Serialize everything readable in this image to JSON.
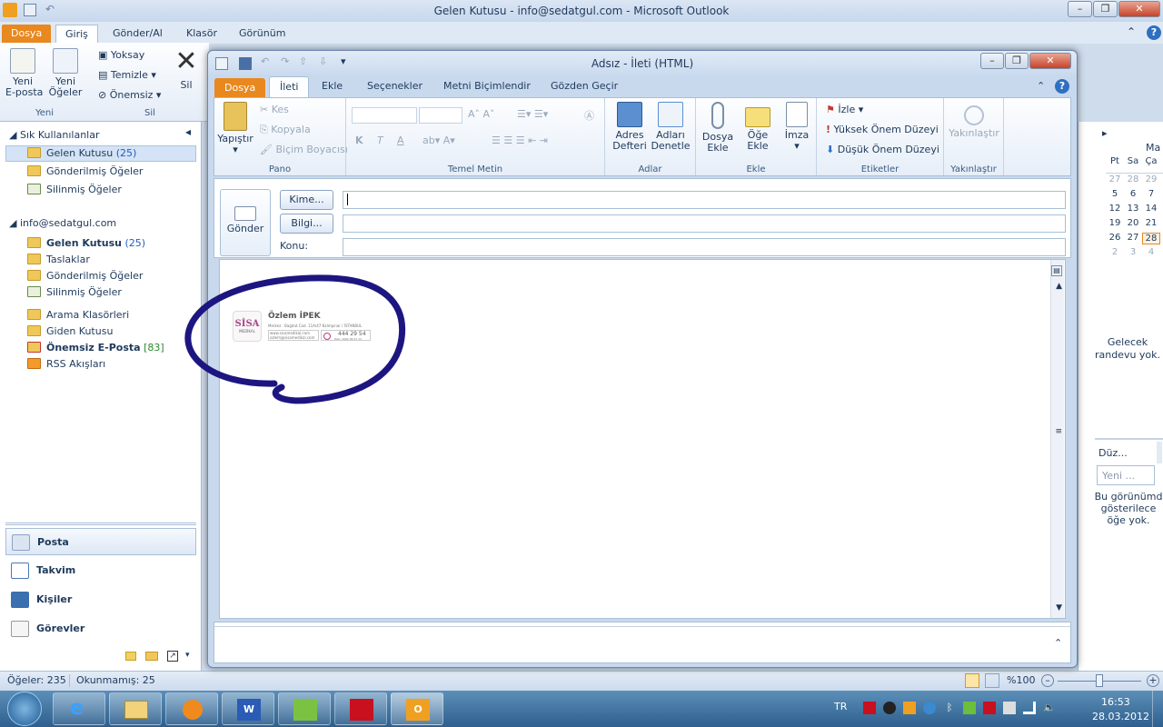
{
  "main_window": {
    "title": "Gelen Kutusu - info@sedatgul.com  -  Microsoft Outlook",
    "tabs": [
      "Dosya",
      "Giriş",
      "Gönder/Al",
      "Klasör",
      "Görünüm"
    ],
    "ribbon": {
      "new_email": "Yeni\nE-posta",
      "new_items": "Yeni\nÖğeler",
      "new_group": "Yeni",
      "ignore": "Yoksay",
      "clean": "Temizle",
      "junk": "Önemsiz",
      "delete": "Sil",
      "delete_group": "Sil"
    }
  },
  "nav": {
    "favorites_header": "Sık Kullanılanlar",
    "favorites": [
      {
        "name": "Gelen Kutusu",
        "count": "(25)"
      },
      {
        "name": "Gönderilmiş Öğeler",
        "count": ""
      },
      {
        "name": "Silinmiş Öğeler",
        "count": ""
      }
    ],
    "account_header": "info@sedatgul.com",
    "account_folders": [
      {
        "name": "Gelen Kutusu",
        "count": "(25)"
      },
      {
        "name": "Taslaklar",
        "count": ""
      },
      {
        "name": "Gönderilmiş Öğeler",
        "count": ""
      },
      {
        "name": "Silinmiş Öğeler",
        "count": ""
      },
      {
        "name": "Arama Klasörleri",
        "count": ""
      },
      {
        "name": "Giden Kutusu",
        "count": ""
      },
      {
        "name": "Önemsiz E-Posta",
        "count": "[83]"
      },
      {
        "name": "RSS Akışları",
        "count": ""
      }
    ],
    "modules": [
      "Posta",
      "Takvim",
      "Kişiler",
      "Görevler"
    ]
  },
  "right_pane": {
    "calendar_header": "Ma",
    "day_names": [
      "Pt",
      "Sa",
      "Ça"
    ],
    "weeks": [
      [
        "27",
        "28",
        "29"
      ],
      [
        "5",
        "6",
        "7"
      ],
      [
        "12",
        "13",
        "14"
      ],
      [
        "19",
        "20",
        "21"
      ],
      [
        "26",
        "27",
        "28"
      ],
      [
        "2",
        "3",
        "4"
      ]
    ],
    "no_appointments": "Gelecek randevu yok.",
    "arrange": "Düz...",
    "new_task": "Yeni ...",
    "task_note": "Bu görünümd gösterilece öğe yok."
  },
  "status": {
    "items": "Öğeler: 235",
    "unread": "Okunmamış: 25",
    "zoom": "%100"
  },
  "taskbar": {
    "lang": "TR",
    "time": "16:53",
    "date": "28.03.2012"
  },
  "compose": {
    "title": "Adsız - İleti (HTML)",
    "tabs": [
      "Dosya",
      "İleti",
      "Ekle",
      "Seçenekler",
      "Metni Biçimlendir",
      "Gözden Geçir"
    ],
    "ribbon": {
      "paste": "Yapıştır",
      "cut": "Kes",
      "copy": "Kopyala",
      "format_painter": "Biçim Boyacısı",
      "clipboard_group": "Pano",
      "basic_text_group": "Temel Metin",
      "bold": "K",
      "italic": "T",
      "underline": "A",
      "address_book": "Adres\nDefteri",
      "check_names": "Adları\nDenetle",
      "names_group": "Adlar",
      "attach_file": "Dosya\nEkle",
      "attach_item": "Öğe\nEkle",
      "signature": "İmza",
      "include_group": "Ekle",
      "follow_up": "İzle",
      "high_importance": "Yüksek Önem Düzeyi",
      "low_importance": "Düşük Önem Düzeyi",
      "tags_group": "Etiketler",
      "zoom": "Yakınlaştır",
      "zoom_group": "Yakınlaştır"
    },
    "send": "Gönder",
    "to_btn": "Kime...",
    "cc_btn": "Bilgi...",
    "subject_label": "Konu:",
    "to_value": "",
    "cc_value": "",
    "subject_value": "",
    "signature": {
      "brand": "SİSA",
      "brand_sub": "MEDİKAL",
      "name": "Özlem İPEK",
      "address": "Merkez : Bağdat Cad. 11A/47 Kalmpınar / İSTANBUL",
      "web": "www.sisamedikal.com",
      "email": "ozlem@sisamedikal.com",
      "phone": "444 29 54",
      "phone_sub": "Dah: 1602 38 47 13"
    }
  },
  "colors": {
    "file_tab": "#e8881e",
    "circle": "#1d1680",
    "accent": "#1e395b"
  }
}
